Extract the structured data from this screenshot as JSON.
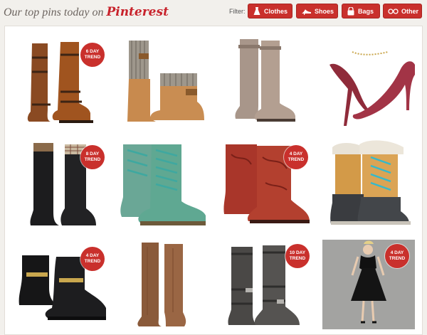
{
  "header": {
    "title": "Our top pins today on",
    "brand": "Pinterest",
    "filter_label": "Filter:",
    "filters": [
      {
        "label": "Clothes",
        "icon": "dress-icon"
      },
      {
        "label": "Shoes",
        "icon": "heel-shoe-icon"
      },
      {
        "label": "Bags",
        "icon": "bag-icon"
      },
      {
        "label": "Other",
        "icon": "glasses-icon"
      }
    ]
  },
  "colors": {
    "accent": "#c9302c",
    "background": "#f2f0ec"
  },
  "pins": [
    {
      "item": "brown leather riding boots",
      "badge_line1": "6 DAY",
      "badge_line2": "TREND"
    },
    {
      "item": "knit sweater boots",
      "badge_line1": "",
      "badge_line2": ""
    },
    {
      "item": "taupe suede tall boots",
      "badge_line1": "",
      "badge_line2": ""
    },
    {
      "item": "burgundy suede pumps",
      "badge_line1": "",
      "badge_line2": ""
    },
    {
      "item": "black rain boots with plaid cuff",
      "badge_line1": "8 DAY",
      "badge_line2": "TREND"
    },
    {
      "item": "teal lace-up combat boots",
      "badge_line1": "",
      "badge_line2": ""
    },
    {
      "item": "red cowboy boots",
      "badge_line1": "4 DAY",
      "badge_line2": "TREND"
    },
    {
      "item": "fur-trimmed winter boots",
      "badge_line1": "",
      "badge_line2": ""
    },
    {
      "item": "black buckle ankle boots",
      "badge_line1": "4 DAY",
      "badge_line2": "TREND"
    },
    {
      "item": "brown tall boots",
      "badge_line1": "",
      "badge_line2": ""
    },
    {
      "item": "grey distressed buckle boots",
      "badge_line1": "10 DAY",
      "badge_line2": "TREND"
    },
    {
      "item": "black cocktail dress",
      "badge_line1": "4 DAY",
      "badge_line2": "TREND"
    }
  ]
}
